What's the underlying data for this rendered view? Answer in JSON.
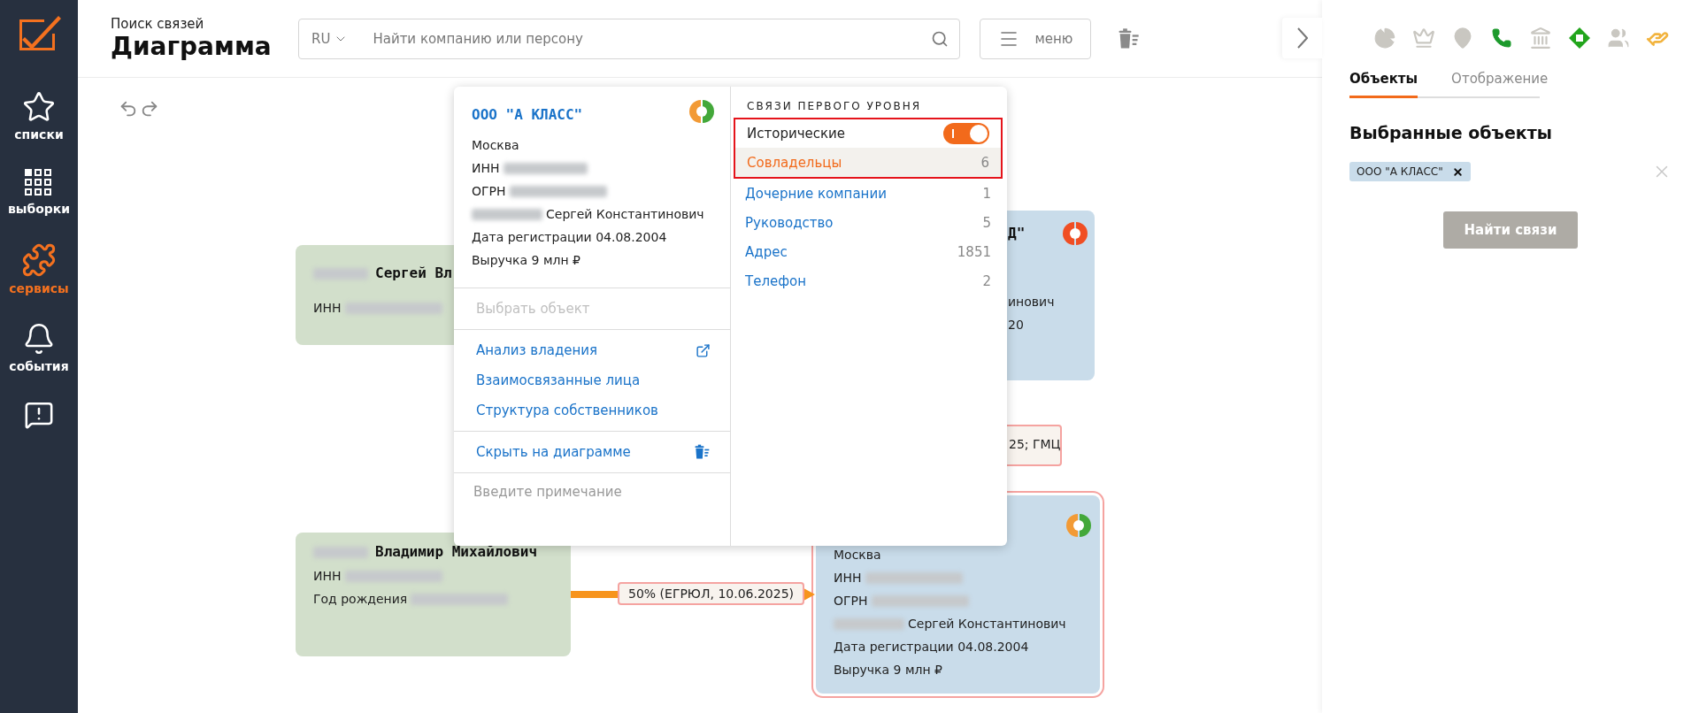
{
  "sidebar": {
    "items": [
      {
        "label": "списки",
        "selected": false
      },
      {
        "label": "выборки",
        "selected": false
      },
      {
        "label": "сервисы",
        "selected": true
      },
      {
        "label": "события",
        "selected": false
      },
      {
        "selected": false
      }
    ]
  },
  "header": {
    "subtitle": "Поиск связей",
    "title": "Диаграмма",
    "search": {
      "language": "RU",
      "placeholder": "Найти компанию или персону"
    },
    "menu_button": "меню"
  },
  "diagram": {
    "nodes": [
      {
        "kind": "person",
        "selected": false,
        "name": "Сергей Вл",
        "name_redacted": true,
        "lines": [
          {
            "text": "ИНН",
            "redacted_after": true
          }
        ]
      },
      {
        "kind": "company",
        "selected": false,
        "name": "Д\"",
        "lines": [
          {
            "text": "инович"
          },
          {
            "text": "20"
          }
        ]
      },
      {
        "kind": "person",
        "selected": false,
        "name": "Владимир Михайлович",
        "name_redacted": true,
        "lines": [
          {
            "text": "ИНН",
            "redacted_after": true
          },
          {
            "text": "Год рождения",
            "redacted_after": true
          }
        ]
      },
      {
        "kind": "company",
        "selected": true,
        "lines": [
          {
            "text": "Москва"
          },
          {
            "text": "ИНН",
            "redacted_after": true
          },
          {
            "text": "ОГРН",
            "redacted_after": true
          },
          {
            "text": "Сергей Константинович",
            "redacted_before": true
          },
          {
            "text": "Дата регистрации 04.08.2004"
          },
          {
            "text": "Выручка 9 млн ₽"
          }
        ]
      }
    ],
    "edges": [
      {
        "kind": "label",
        "label": "25; ГМЦ"
      },
      {
        "kind": "arrow",
        "label": "50% (ЕГРЮЛ, 10.06.2025)"
      }
    ]
  },
  "popup": {
    "title": "ООО \"А КЛАСС\"",
    "lines": [
      {
        "text": "Москва"
      },
      {
        "text": "ИНН",
        "redacted_after": true
      },
      {
        "text": "ОГРН",
        "redacted_after": true
      },
      {
        "text": "Сергей Константинович",
        "redacted_before": true
      },
      {
        "text": "Дата регистрации 04.08.2004"
      },
      {
        "text": "Выручка 9 млн ₽"
      }
    ],
    "action_groups": [
      [
        {
          "label": "Выбрать объект",
          "disabled": true
        }
      ],
      [
        {
          "label": "Анализ владения",
          "disabled": false
        },
        {
          "label": "Взаимосвязанные лица",
          "disabled": false
        },
        {
          "label": "Структура собственников",
          "disabled": false
        }
      ],
      [
        {
          "label": "Скрыть на диаграмме",
          "disabled": false
        }
      ]
    ],
    "note": {
      "placeholder": "Введите примечание"
    },
    "links": {
      "heading": "СВЯЗИ ПЕРВОГО УРОВНЯ",
      "highlight": true,
      "historical": {
        "label": "Исторические",
        "on": true
      },
      "items": [
        {
          "label": "Совладельцы",
          "count": "6",
          "selected": true
        },
        {
          "label": "Дочерние компании",
          "count": "1",
          "selected": false
        },
        {
          "label": "Руководство",
          "count": "5",
          "selected": false
        },
        {
          "label": "Адрес",
          "count": "1851",
          "selected": false
        },
        {
          "label": "Телефон",
          "count": "2",
          "selected": false
        }
      ]
    }
  },
  "right_panel": {
    "filters": [
      {
        "color": "#c9c7c1"
      },
      {
        "color": "#c9c7c1"
      },
      {
        "color": "#c9c7c1"
      },
      {
        "color": "#1c9a2c"
      },
      {
        "color": "#c9c7c1"
      },
      {
        "color": "#22a51c"
      },
      {
        "color": "#c9c7c1"
      },
      {
        "color": "#f2b33d"
      }
    ],
    "tabs": [
      {
        "label": "Объекты",
        "selected": true
      },
      {
        "label": "Отображение",
        "selected": false
      }
    ],
    "heading": "Выбранные объекты",
    "chips": [
      {
        "label": "ООО \"А КЛАСС\""
      }
    ],
    "button": {
      "label": "Найти связи",
      "disabled": true
    }
  }
}
